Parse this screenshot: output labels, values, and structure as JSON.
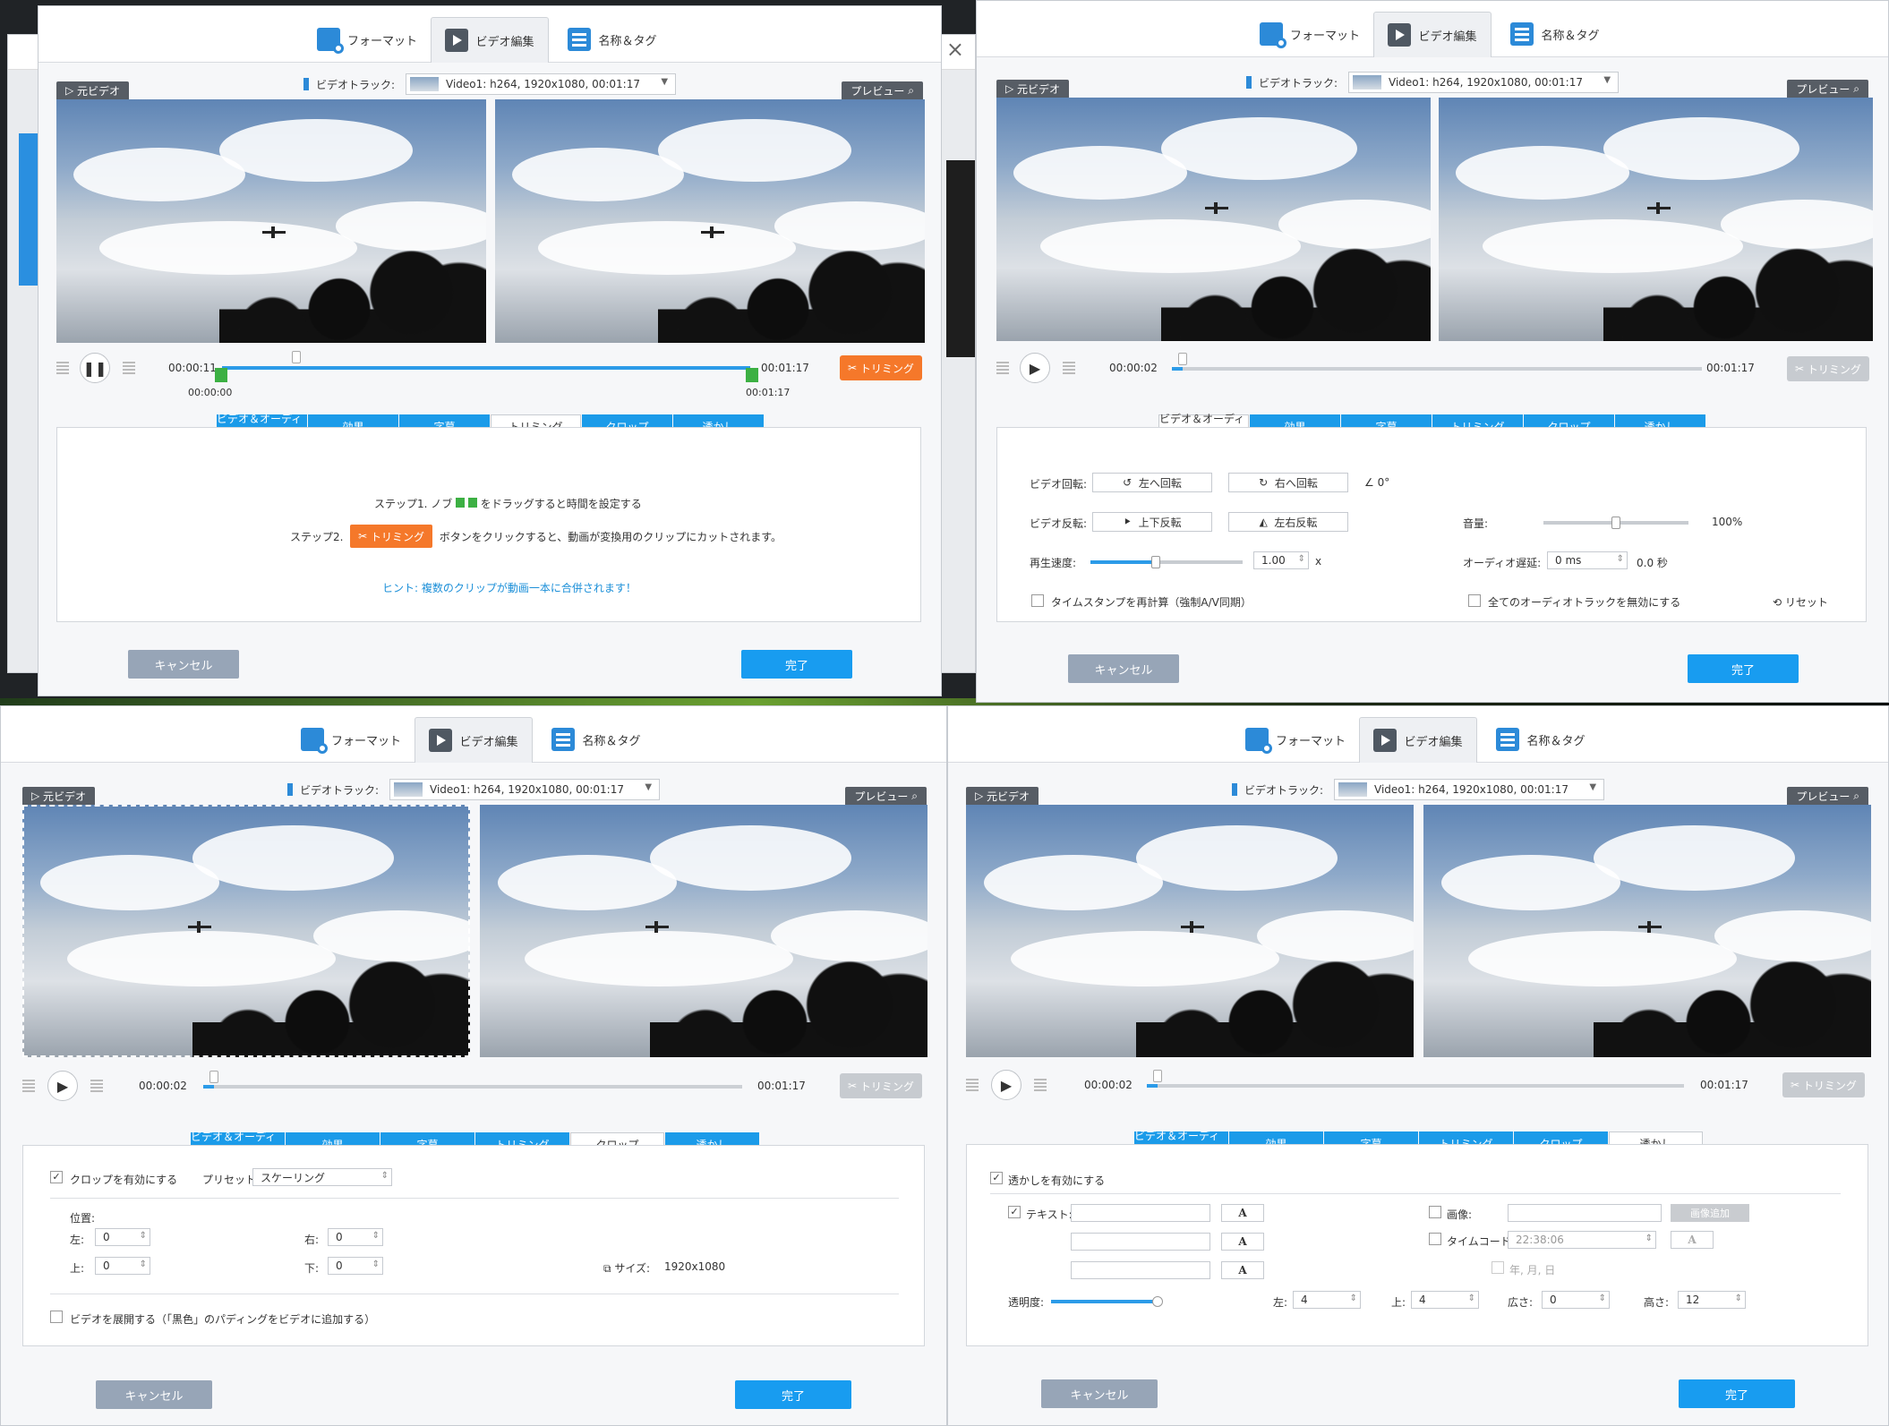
{
  "tabs": {
    "format": "フォーマット",
    "video_edit": "ビデオ編集",
    "name_tag": "名称＆タグ"
  },
  "track": {
    "label": "ビデオトラック:",
    "value": "Video1: h264, 1920x1080, 00:01:17"
  },
  "labels": {
    "original": "元ビデオ",
    "preview": "プレビュー"
  },
  "subtabs": [
    "ビデオ＆オーディオ",
    "効果",
    "字幕",
    "トリミング",
    "クロップ",
    "透かし"
  ],
  "trim_button": "トリミング",
  "footer": {
    "cancel": "キャンセル",
    "done": "完了"
  },
  "icons": {
    "close": "close-icon",
    "play": "play-icon",
    "pause": "pause-icon",
    "search": "search-icon",
    "scissors": "scissors-icon"
  },
  "colors": {
    "accent": "#189cf0",
    "orange": "#f5782a",
    "flag": "#3cb043"
  },
  "p1": {
    "time_current": "00:00:11",
    "time_start": "00:00:00",
    "time_end": "00:01:17",
    "time_end2": "00:01:17",
    "progress": 0.14,
    "step1_pre": "ステップ1. ノブ",
    "step1_post": "をドラッグすると時間を設定する",
    "step2_pre": "ステップ2.",
    "step2_post": "ボタンをクリックすると、動画が変換用のクリップにカットされます。",
    "hint": "ヒント: 複数のクリップが動画一本に合併されます！"
  },
  "p2": {
    "time_current": "00:00:02",
    "time_end": "00:01:17",
    "progress": 0.02,
    "rotate_label": "ビデオ回転:",
    "rotate_left": "左へ回転",
    "rotate_right": "右へ回転",
    "angle": "0°",
    "flip_label": "ビデオ反転:",
    "flip_v": "上下反転",
    "flip_h": "左右反転",
    "volume_label": "音量:",
    "volume_value": "100%",
    "volume_level": 0.5,
    "speed_label": "再生速度:",
    "speed_value": "1.00",
    "speed_unit": "x",
    "speed_level": 0.43,
    "delay_label": "オーディオ遅延:",
    "delay_value": "0 ms",
    "delay_seconds": "0.0 秒",
    "timestamp_label": "タイムスタンプを再計算（強制A/V同期）",
    "disable_audio_label": "全てのオーディオトラックを無効にする",
    "reset": "リセット"
  },
  "p3": {
    "time_current": "00:00:02",
    "time_end": "00:01:17",
    "progress": 0.02,
    "enable_crop": "クロップを有効にする",
    "preset_label": "プリセット:",
    "preset_value": "スケーリング",
    "position_label": "位置:",
    "left_label": "左:",
    "right_label": "右:",
    "top_label": "上:",
    "bottom_label": "下:",
    "left": "0",
    "right": "0",
    "top": "0",
    "bottom": "0",
    "size_label": "サイズ:",
    "size_value": "1920x1080",
    "expand_label": "ビデオを展開する（「黒色」のパディングをビデオに追加する）"
  },
  "p4": {
    "time_current": "00:00:02",
    "time_end": "00:01:17",
    "progress": 0.02,
    "enable_wm": "透かしを有効にする",
    "text_label": "テキスト:",
    "image_label": "画像:",
    "add_image": "画像追加",
    "timecode_label": "タイムコード:",
    "timecode_value": "22:38:06",
    "date_label": "年, 月, 日",
    "opacity_label": "透明度:",
    "opacity_level": 0.95,
    "left_label": "左:",
    "left": "4",
    "top_label": "上:",
    "top": "4",
    "width_label": "広さ:",
    "width": "0",
    "height_label": "高さ:",
    "height": "12",
    "a_glyph": "A"
  }
}
